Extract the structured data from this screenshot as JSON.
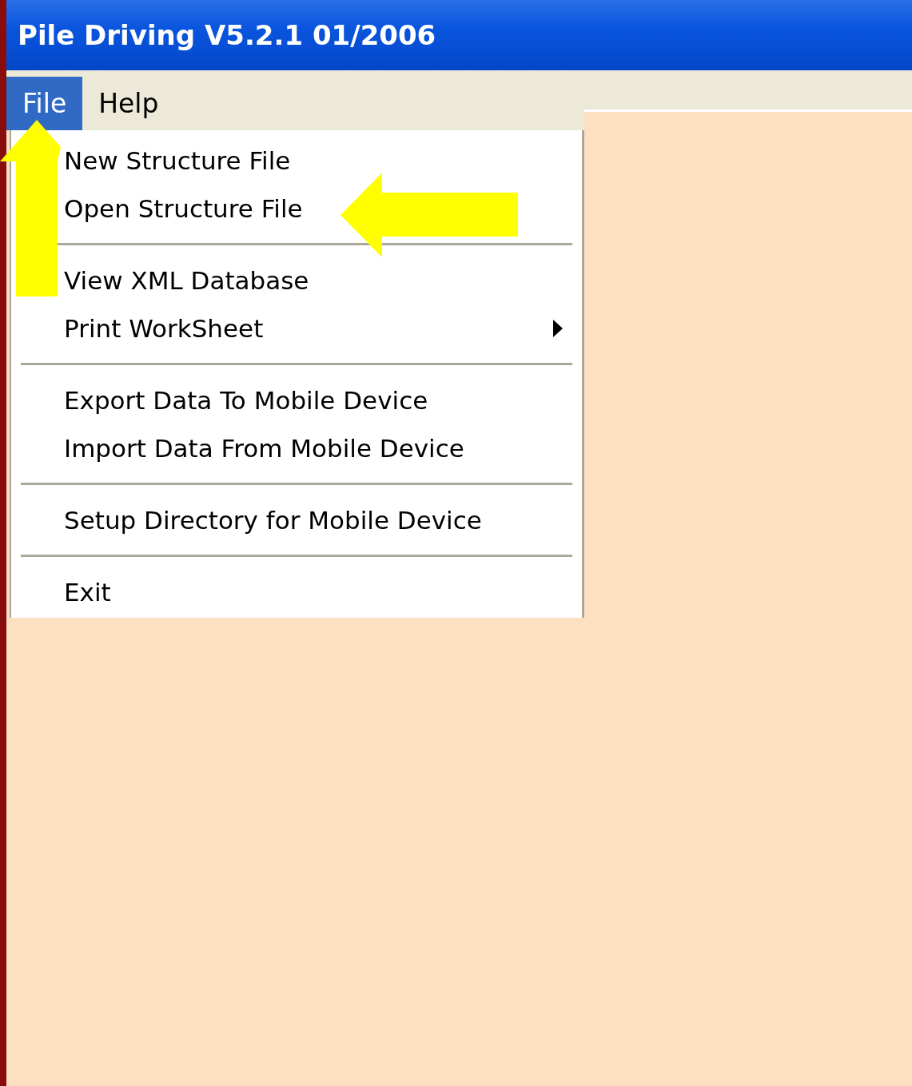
{
  "window": {
    "title": "Pile Driving V5.2.1 01/2006"
  },
  "menubar": [
    {
      "label": "File",
      "selected": true
    },
    {
      "label": "Help",
      "selected": false
    }
  ],
  "file_menu": [
    {
      "kind": "item",
      "label": "New Structure File",
      "submenu": false
    },
    {
      "kind": "item",
      "label": "Open Structure File",
      "submenu": false
    },
    {
      "kind": "separator"
    },
    {
      "kind": "item",
      "label": "View XML Database",
      "submenu": false
    },
    {
      "kind": "item",
      "label": "Print WorkSheet",
      "submenu": true
    },
    {
      "kind": "separator"
    },
    {
      "kind": "item",
      "label": "Export Data To Mobile Device",
      "submenu": false
    },
    {
      "kind": "item",
      "label": "Import Data From Mobile Device",
      "submenu": false
    },
    {
      "kind": "separator"
    },
    {
      "kind": "item",
      "label": "Setup Directory for Mobile Device",
      "submenu": false
    },
    {
      "kind": "separator"
    },
    {
      "kind": "item",
      "label": "Exit",
      "submenu": false
    }
  ]
}
